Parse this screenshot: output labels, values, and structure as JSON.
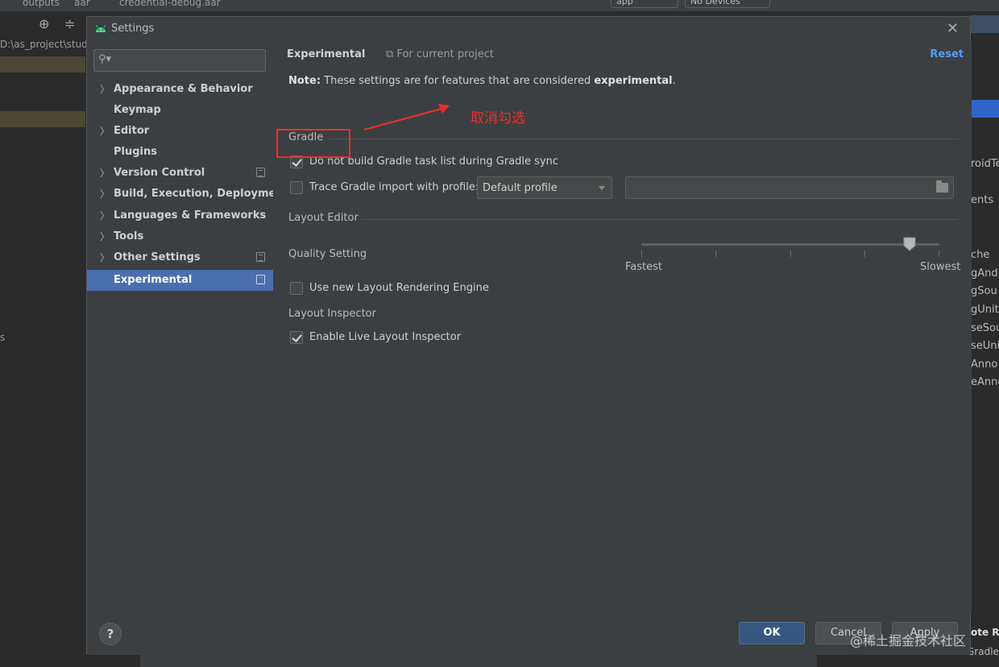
{
  "ide": {
    "crumbs": [
      "outputs",
      "aar",
      "credential-debug.aar"
    ],
    "run_config": "app",
    "device": "No Devices",
    "path_fragment": "D:\\as_project\\stud",
    "left_letter": "s",
    "right_fragments": [
      "roidTe",
      "ents",
      "che",
      "gAnd",
      "gSou",
      "gUnit",
      "seSou",
      "seUni",
      "Anno",
      "eAnno"
    ],
    "right_bottom_1": "ote R",
    "right_bottom_2": "Gradle I"
  },
  "dialog": {
    "title": "Settings",
    "search": {
      "placeholder": ""
    },
    "nav": [
      {
        "label": "Appearance & Behavior",
        "expandable": true,
        "project": false
      },
      {
        "label": "Keymap",
        "expandable": false,
        "project": false
      },
      {
        "label": "Editor",
        "expandable": true,
        "project": false
      },
      {
        "label": "Plugins",
        "expandable": false,
        "project": false
      },
      {
        "label": "Version Control",
        "expandable": true,
        "project": true
      },
      {
        "label": "Build, Execution, Deployment",
        "expandable": true,
        "project": false
      },
      {
        "label": "Languages & Frameworks",
        "expandable": true,
        "project": false
      },
      {
        "label": "Tools",
        "expandable": true,
        "project": false
      },
      {
        "label": "Other Settings",
        "expandable": true,
        "project": true
      },
      {
        "label": "Experimental",
        "expandable": false,
        "project": true,
        "active": true
      }
    ],
    "content": {
      "title": "Experimental",
      "scope": "For current project",
      "reset": "Reset",
      "note_prefix": "Note:",
      "note_body": " These settings are for features that are considered ",
      "note_bold": "experimental",
      "note_end": ".",
      "gradle": {
        "section": "Gradle",
        "do_not_build_label": "Do not build Gradle task list during Gradle sync",
        "do_not_build_checked": true,
        "trace_label": "Trace Gradle import with profile:",
        "trace_checked": false,
        "profile_value": "Default profile",
        "profile_path": ""
      },
      "layout_editor": {
        "section": "Layout Editor",
        "quality_label": "Quality Setting",
        "slider_min_label": "Fastest",
        "slider_max_label": "Slowest",
        "slider_value_fraction": 0.9,
        "new_engine_label": "Use new Layout Rendering Engine",
        "new_engine_checked": false
      },
      "layout_inspector": {
        "section": "Layout Inspector",
        "live_label": "Enable Live Layout Inspector",
        "live_checked": true
      }
    },
    "footer": {
      "help": "?",
      "ok": "OK",
      "cancel": "Cancel",
      "apply": "Apply"
    }
  },
  "annotation": {
    "text": "取消勾选",
    "color": "#e8312a"
  },
  "watermark": "@稀土掘金技术社区",
  "colors": {
    "accent": "#4b6eaf",
    "link": "#589df6",
    "ok_button": "#365880",
    "android_green": "#3ddc84"
  }
}
